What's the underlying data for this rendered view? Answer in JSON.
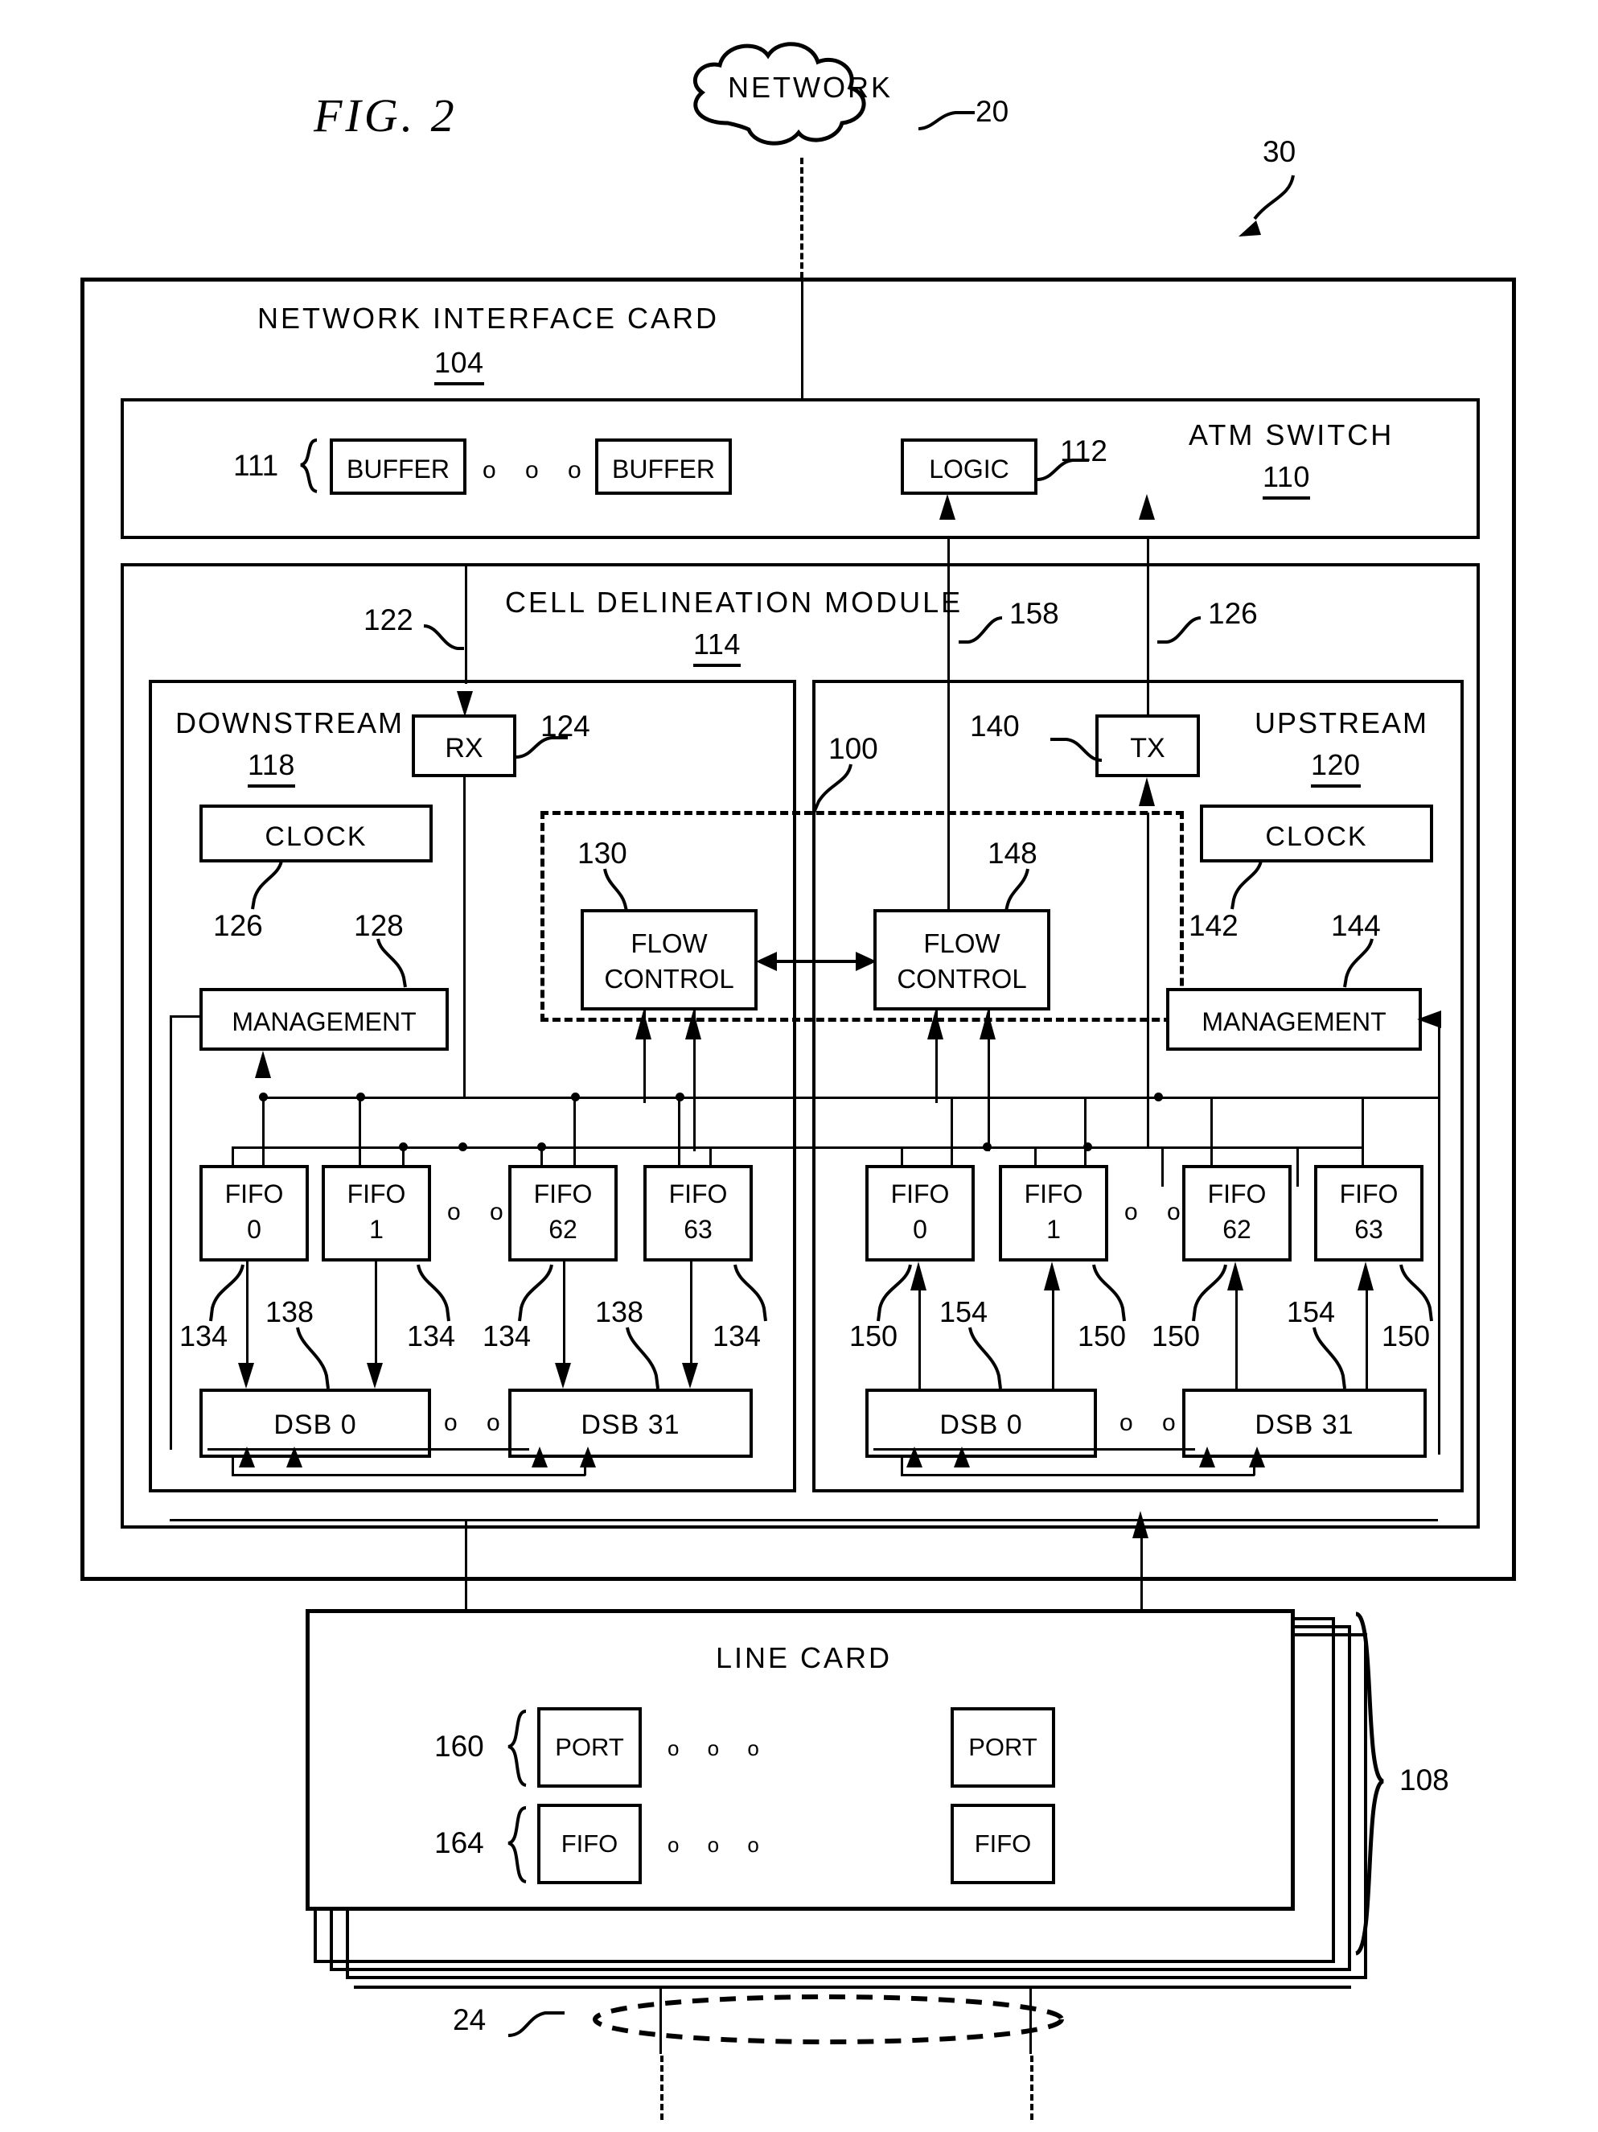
{
  "figure": {
    "title": "FIG.  2",
    "system_ref": "30"
  },
  "network": {
    "label": "NETWORK",
    "ref": "20"
  },
  "nic": {
    "title": "NETWORK INTERFACE CARD",
    "ref": "104"
  },
  "atm_switch": {
    "title": "ATM SWITCH",
    "ref": "110",
    "buffer_group_ref": "111",
    "buffers": [
      "BUFFER",
      "BUFFER"
    ],
    "buffer_ellipsis": "o o o",
    "logic": {
      "label": "LOGIC",
      "ref": "112"
    }
  },
  "cdm": {
    "title": "CELL DELINEATION MODULE",
    "ref": "114",
    "link_refs": {
      "rx_path": "122",
      "flow_path": "158",
      "tx_path": "126"
    }
  },
  "downstream": {
    "title": "DOWNSTREAM",
    "ref": "118",
    "rx": {
      "label": "RX",
      "ref": "124"
    },
    "clock": {
      "label": "CLOCK",
      "ref": "126"
    },
    "management": {
      "label": "MANAGEMENT",
      "ref": "128"
    },
    "fifos": [
      {
        "name": "FIFO",
        "index": "0"
      },
      {
        "name": "FIFO",
        "index": "1"
      },
      {
        "name": "FIFO",
        "index": "62"
      },
      {
        "name": "FIFO",
        "index": "63"
      }
    ],
    "fifo_ellipsis": "o o",
    "dsbs": [
      "DSB  0",
      "DSB  31"
    ],
    "dsb_ellipsis": "o o",
    "line_refs": {
      "fifo_out": "134",
      "dsb_in": "138"
    },
    "ref_row": [
      "134",
      "138",
      "134",
      "134",
      "138",
      "134"
    ]
  },
  "flow_control_group": {
    "ref": "100",
    "downstream_fc": {
      "label_line1": "FLOW",
      "label_line2": "CONTROL",
      "ref": "130"
    },
    "upstream_fc": {
      "label_line1": "FLOW",
      "label_line2": "CONTROL",
      "ref": "148"
    }
  },
  "upstream": {
    "title": "UPSTREAM",
    "ref": "120",
    "tx": {
      "label": "TX",
      "ref": "140"
    },
    "clock": {
      "label": "CLOCK",
      "ref": "142"
    },
    "management": {
      "label": "MANAGEMENT",
      "ref": "144"
    },
    "fifos": [
      {
        "name": "FIFO",
        "index": "0"
      },
      {
        "name": "FIFO",
        "index": "1"
      },
      {
        "name": "FIFO",
        "index": "62"
      },
      {
        "name": "FIFO",
        "index": "63"
      }
    ],
    "fifo_ellipsis": "o o",
    "dsbs": [
      "DSB  0",
      "DSB  31"
    ],
    "dsb_ellipsis": "o o",
    "line_refs": {
      "fifo_in": "150",
      "dsb_out": "154"
    },
    "ref_row": [
      "150",
      "154",
      "150",
      "150",
      "154",
      "150"
    ]
  },
  "line_card": {
    "title": "LINE CARD",
    "stack_ref": "108",
    "port_group_ref": "160",
    "fifo_group_ref": "164",
    "ports": [
      "PORT",
      "PORT"
    ],
    "fifos": [
      "FIFO",
      "FIFO"
    ],
    "port_ellipsis": "o      o      o",
    "fifo_ellipsis": "o      o      o"
  },
  "bus": {
    "ref": "24"
  }
}
